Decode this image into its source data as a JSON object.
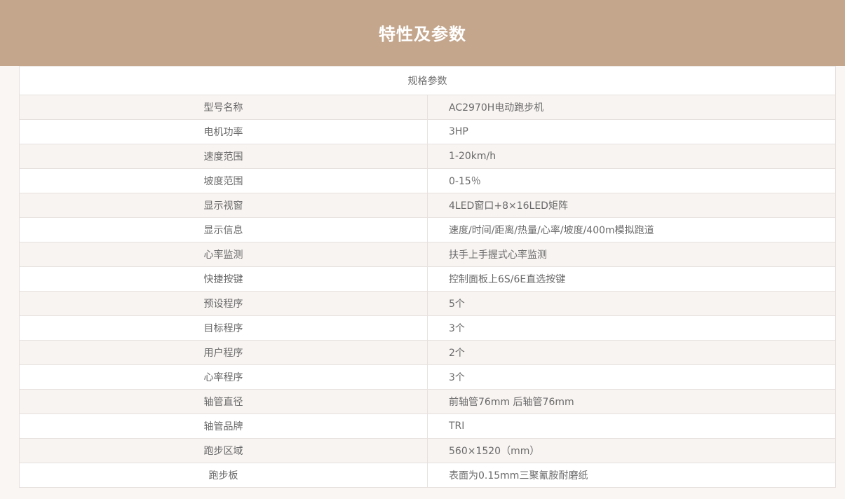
{
  "header": {
    "title": "特性及参数"
  },
  "table": {
    "caption": "规格参数",
    "rows": [
      {
        "label": "型号名称",
        "value": "AC2970H电动跑步机"
      },
      {
        "label": "电机功率",
        "value": "3HP"
      },
      {
        "label": "速度范围",
        "value": "1-20km/h"
      },
      {
        "label": "坡度范围",
        "value": "0-15％"
      },
      {
        "label": "显示视窗",
        "value": "4LED窗口+8×16LED矩阵"
      },
      {
        "label": "显示信息",
        "value": "速度/时间/距离/热量/心率/坡度/400m模拟跑道"
      },
      {
        "label": "心率监测",
        "value": "扶手上手握式心率监测"
      },
      {
        "label": "快捷按键",
        "value": "控制面板上6S/6E直选按键"
      },
      {
        "label": "预设程序",
        "value": "5个"
      },
      {
        "label": "目标程序",
        "value": "3个"
      },
      {
        "label": "用户程序",
        "value": "2个"
      },
      {
        "label": "心率程序",
        "value": "3个"
      },
      {
        "label": "轴管直径",
        "value": "前轴管76mm 后轴管76mm"
      },
      {
        "label": "轴管品牌",
        "value": "TRI"
      },
      {
        "label": "跑步区域",
        "value": "560×1520（mm）"
      },
      {
        "label": "跑步板",
        "value": "表面为0.15mm三聚氰胺耐磨纸"
      }
    ]
  }
}
